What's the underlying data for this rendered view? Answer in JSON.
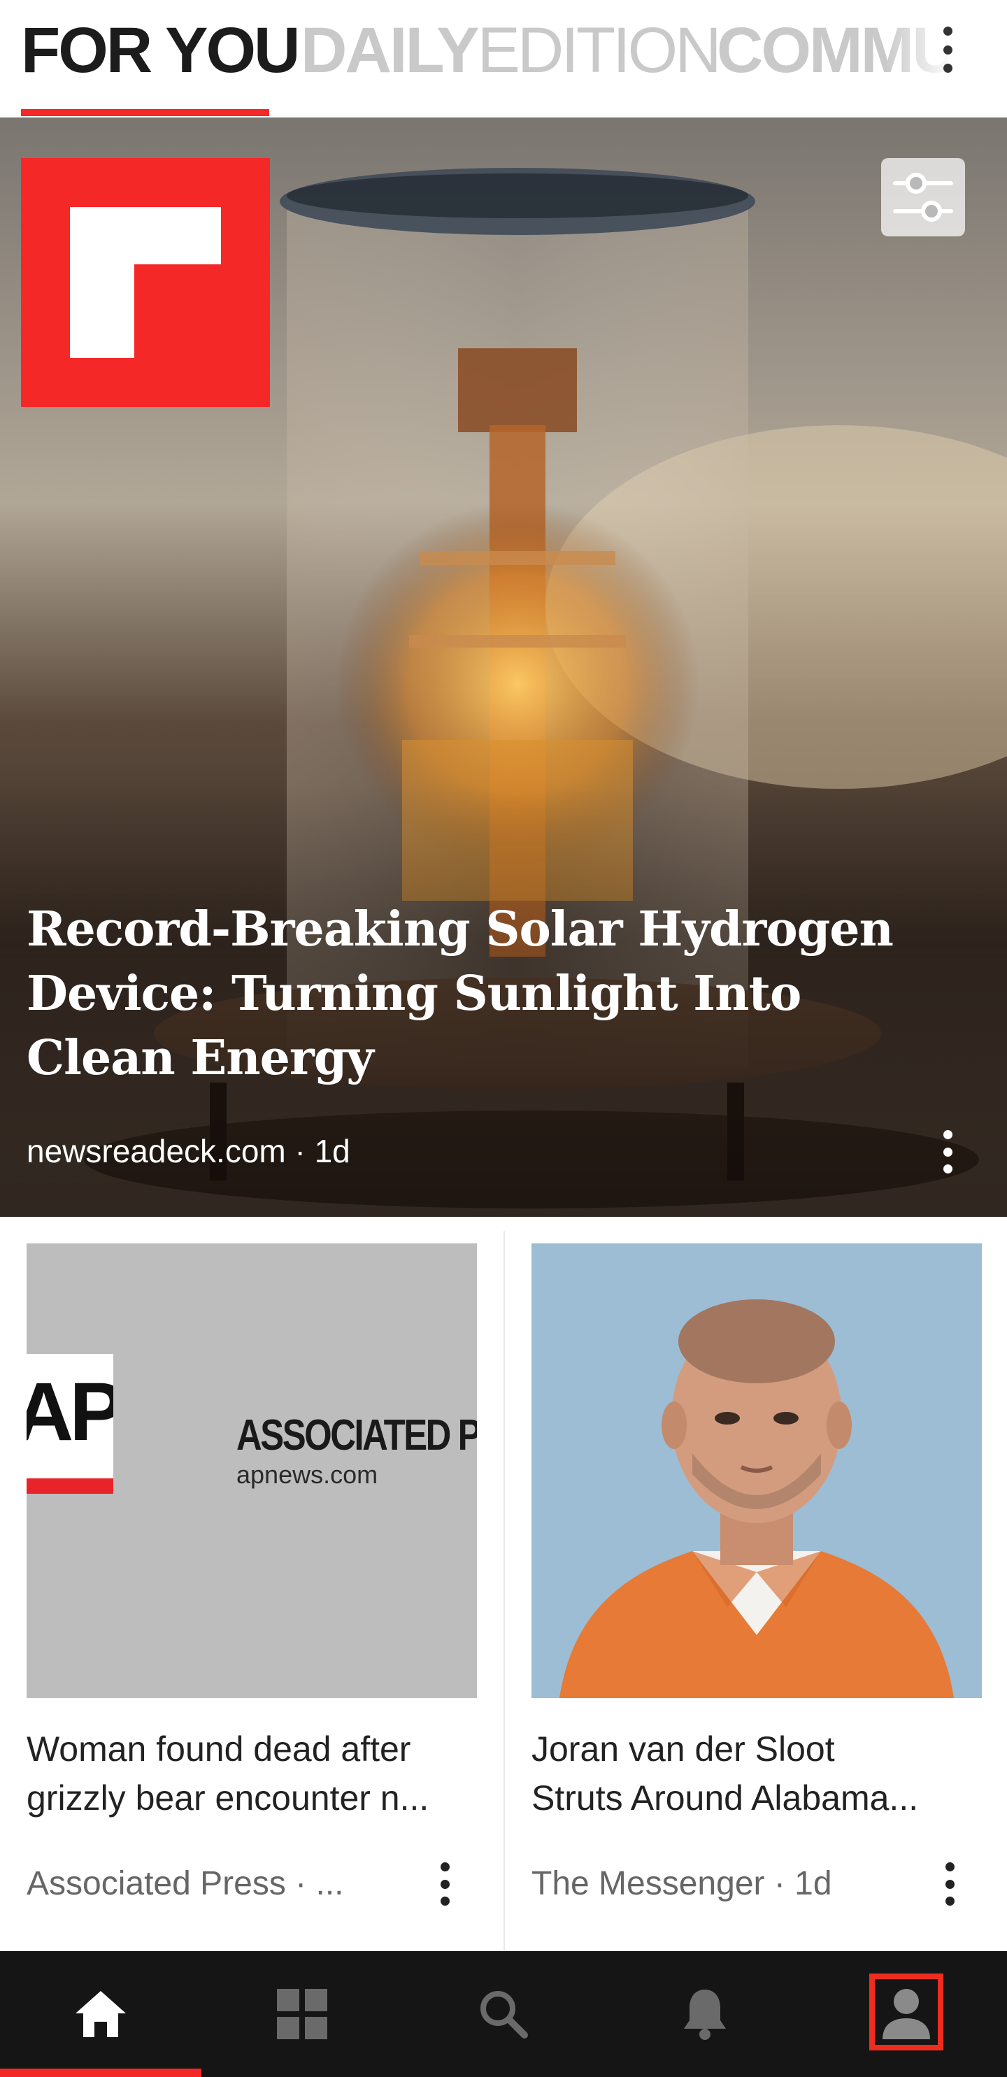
{
  "tabs": {
    "for_you": "FOR YOU",
    "daily_edition": {
      "bold": "DAILY",
      "thin": "EDITION"
    },
    "community": "COMMU"
  },
  "hero": {
    "title": "Record-Breaking Solar Hydrogen Device: Turning Sunlight Into Clean Energy",
    "source": "newsreadeck.com · 1d"
  },
  "cards": [
    {
      "title_lines": [
        "Woman found dead after",
        "grizzly bear encounter n..."
      ],
      "source": "Associated Press · ...",
      "image": {
        "logo_text": "AP",
        "name": "ASSOCIATED PRE",
        "url": "apnews.com"
      }
    },
    {
      "title_lines": [
        "Joran van der Sloot",
        "Struts Around Alabama..."
      ],
      "source": "The Messenger · 1d"
    }
  ],
  "bottom_nav": [
    "home-icon",
    "grid-icon",
    "search-icon",
    "bell-icon",
    "profile-icon"
  ],
  "colors": {
    "accent": "#f52828",
    "nav_bg": "#151515",
    "highlight": "#ee2d1f"
  }
}
